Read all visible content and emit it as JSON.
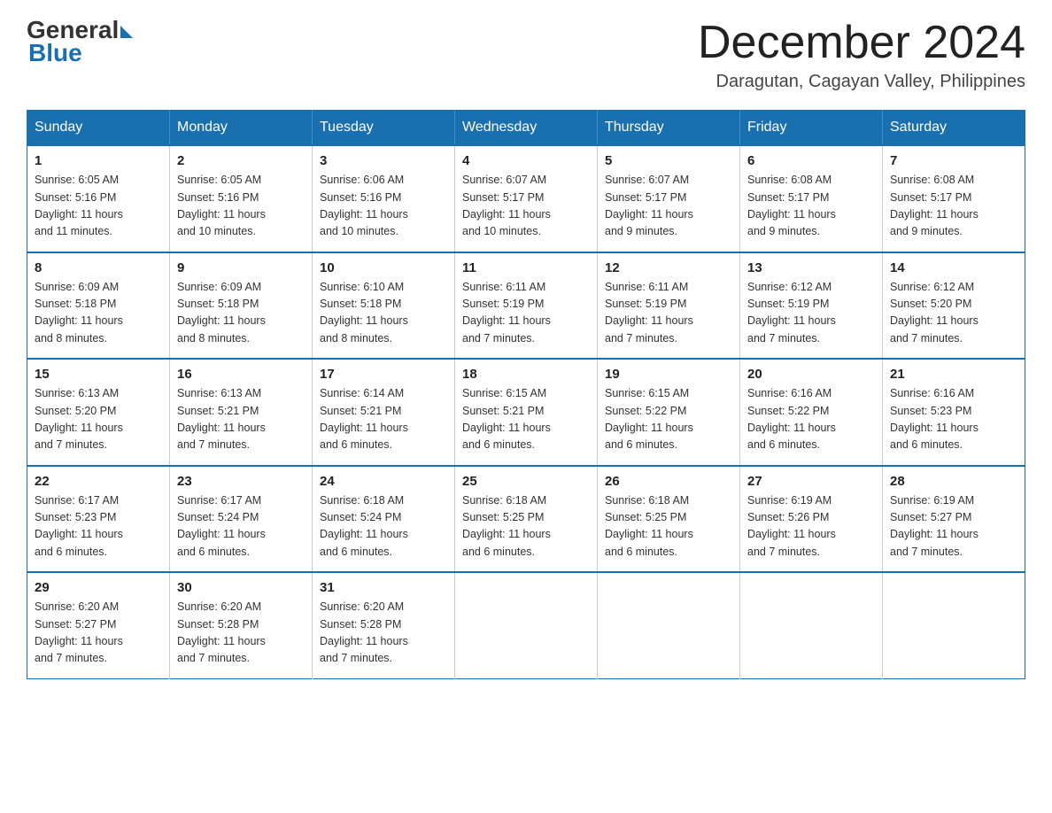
{
  "logo": {
    "general": "General",
    "blue": "Blue"
  },
  "title": {
    "month": "December 2024",
    "location": "Daragutan, Cagayan Valley, Philippines"
  },
  "weekdays": [
    "Sunday",
    "Monday",
    "Tuesday",
    "Wednesday",
    "Thursday",
    "Friday",
    "Saturday"
  ],
  "weeks": [
    [
      {
        "day": "1",
        "sunrise": "6:05 AM",
        "sunset": "5:16 PM",
        "daylight": "11 hours and 11 minutes."
      },
      {
        "day": "2",
        "sunrise": "6:05 AM",
        "sunset": "5:16 PM",
        "daylight": "11 hours and 10 minutes."
      },
      {
        "day": "3",
        "sunrise": "6:06 AM",
        "sunset": "5:16 PM",
        "daylight": "11 hours and 10 minutes."
      },
      {
        "day": "4",
        "sunrise": "6:07 AM",
        "sunset": "5:17 PM",
        "daylight": "11 hours and 10 minutes."
      },
      {
        "day": "5",
        "sunrise": "6:07 AM",
        "sunset": "5:17 PM",
        "daylight": "11 hours and 9 minutes."
      },
      {
        "day": "6",
        "sunrise": "6:08 AM",
        "sunset": "5:17 PM",
        "daylight": "11 hours and 9 minutes."
      },
      {
        "day": "7",
        "sunrise": "6:08 AM",
        "sunset": "5:17 PM",
        "daylight": "11 hours and 9 minutes."
      }
    ],
    [
      {
        "day": "8",
        "sunrise": "6:09 AM",
        "sunset": "5:18 PM",
        "daylight": "11 hours and 8 minutes."
      },
      {
        "day": "9",
        "sunrise": "6:09 AM",
        "sunset": "5:18 PM",
        "daylight": "11 hours and 8 minutes."
      },
      {
        "day": "10",
        "sunrise": "6:10 AM",
        "sunset": "5:18 PM",
        "daylight": "11 hours and 8 minutes."
      },
      {
        "day": "11",
        "sunrise": "6:11 AM",
        "sunset": "5:19 PM",
        "daylight": "11 hours and 7 minutes."
      },
      {
        "day": "12",
        "sunrise": "6:11 AM",
        "sunset": "5:19 PM",
        "daylight": "11 hours and 7 minutes."
      },
      {
        "day": "13",
        "sunrise": "6:12 AM",
        "sunset": "5:19 PM",
        "daylight": "11 hours and 7 minutes."
      },
      {
        "day": "14",
        "sunrise": "6:12 AM",
        "sunset": "5:20 PM",
        "daylight": "11 hours and 7 minutes."
      }
    ],
    [
      {
        "day": "15",
        "sunrise": "6:13 AM",
        "sunset": "5:20 PM",
        "daylight": "11 hours and 7 minutes."
      },
      {
        "day": "16",
        "sunrise": "6:13 AM",
        "sunset": "5:21 PM",
        "daylight": "11 hours and 7 minutes."
      },
      {
        "day": "17",
        "sunrise": "6:14 AM",
        "sunset": "5:21 PM",
        "daylight": "11 hours and 6 minutes."
      },
      {
        "day": "18",
        "sunrise": "6:15 AM",
        "sunset": "5:21 PM",
        "daylight": "11 hours and 6 minutes."
      },
      {
        "day": "19",
        "sunrise": "6:15 AM",
        "sunset": "5:22 PM",
        "daylight": "11 hours and 6 minutes."
      },
      {
        "day": "20",
        "sunrise": "6:16 AM",
        "sunset": "5:22 PM",
        "daylight": "11 hours and 6 minutes."
      },
      {
        "day": "21",
        "sunrise": "6:16 AM",
        "sunset": "5:23 PM",
        "daylight": "11 hours and 6 minutes."
      }
    ],
    [
      {
        "day": "22",
        "sunrise": "6:17 AM",
        "sunset": "5:23 PM",
        "daylight": "11 hours and 6 minutes."
      },
      {
        "day": "23",
        "sunrise": "6:17 AM",
        "sunset": "5:24 PM",
        "daylight": "11 hours and 6 minutes."
      },
      {
        "day": "24",
        "sunrise": "6:18 AM",
        "sunset": "5:24 PM",
        "daylight": "11 hours and 6 minutes."
      },
      {
        "day": "25",
        "sunrise": "6:18 AM",
        "sunset": "5:25 PM",
        "daylight": "11 hours and 6 minutes."
      },
      {
        "day": "26",
        "sunrise": "6:18 AM",
        "sunset": "5:25 PM",
        "daylight": "11 hours and 6 minutes."
      },
      {
        "day": "27",
        "sunrise": "6:19 AM",
        "sunset": "5:26 PM",
        "daylight": "11 hours and 7 minutes."
      },
      {
        "day": "28",
        "sunrise": "6:19 AM",
        "sunset": "5:27 PM",
        "daylight": "11 hours and 7 minutes."
      }
    ],
    [
      {
        "day": "29",
        "sunrise": "6:20 AM",
        "sunset": "5:27 PM",
        "daylight": "11 hours and 7 minutes."
      },
      {
        "day": "30",
        "sunrise": "6:20 AM",
        "sunset": "5:28 PM",
        "daylight": "11 hours and 7 minutes."
      },
      {
        "day": "31",
        "sunrise": "6:20 AM",
        "sunset": "5:28 PM",
        "daylight": "11 hours and 7 minutes."
      },
      null,
      null,
      null,
      null
    ]
  ]
}
